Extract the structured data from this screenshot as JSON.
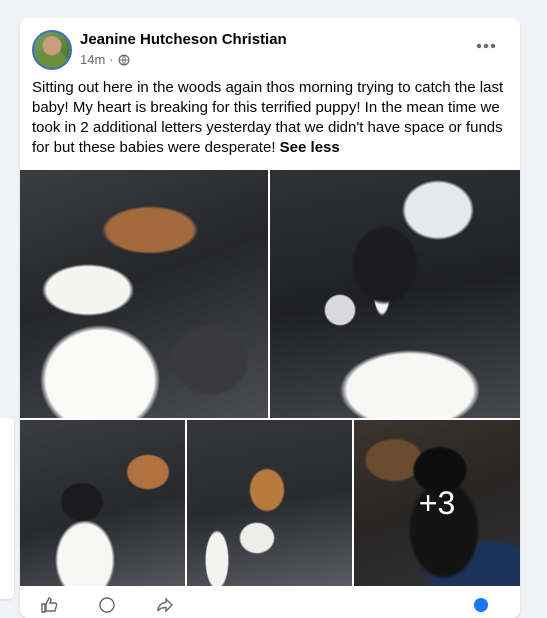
{
  "post": {
    "author": "Jeanine Hutcheson Christian",
    "time": "14m",
    "privacy_icon": "globe-icon",
    "more_icon": "more-horizontal-icon",
    "text": "Sitting out here in the woods again thos morning trying to catch the last baby! My heart is breaking for this terrified puppy! In the mean time we took in 2 additional letters yesterday that we didn't have space or funds for but these babies were desperate!",
    "see_less_label": "See less"
  },
  "photos": {
    "items": [
      {
        "icon": "photo-puppies-car-floor"
      },
      {
        "icon": "photo-puppy-car-seat"
      },
      {
        "icon": "photo-puppies-floor"
      },
      {
        "icon": "photo-puppies-console"
      },
      {
        "icon": "photo-black-puppy"
      }
    ],
    "more_count": "+3"
  },
  "colors": {
    "background": "#f0f2f5",
    "card": "#ffffff",
    "text": "#050505",
    "secondary_text": "#65676b"
  }
}
